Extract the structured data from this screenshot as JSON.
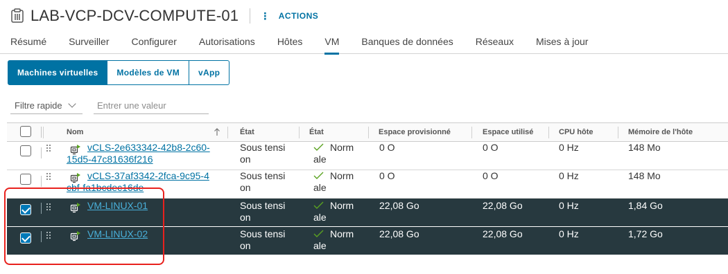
{
  "header": {
    "title": "LAB-VCP-DCV-COMPUTE-01",
    "actions_label": "ACTIONS"
  },
  "tabs": [
    {
      "label": "Résumé"
    },
    {
      "label": "Surveiller"
    },
    {
      "label": "Configurer"
    },
    {
      "label": "Autorisations"
    },
    {
      "label": "Hôtes"
    },
    {
      "label": "VM",
      "active": true
    },
    {
      "label": "Banques de données"
    },
    {
      "label": "Réseaux"
    },
    {
      "label": "Mises à jour"
    }
  ],
  "segments": [
    {
      "label": "Machines virtuelles",
      "active": true
    },
    {
      "label": "Modèles de VM"
    },
    {
      "label": "vApp"
    }
  ],
  "filter": {
    "select_value": "Filtre rapide",
    "input_placeholder": "Entrer une valeur"
  },
  "table": {
    "columns": {
      "name": "Nom",
      "state": "État",
      "status": "État",
      "provisioned": "Espace provisionné",
      "used": "Espace utilisé",
      "cpu": "CPU hôte",
      "memory": "Mémoire de l'hôte"
    },
    "rows": [
      {
        "name_line1": "vCLS-2e633342-42b8-2c60-",
        "name_line2": "15d5-47c81636f216",
        "state_line1": "Sous tensi",
        "state_line2": "on",
        "status_line1": "Norm",
        "status_line2": "ale",
        "provisioned": "0 O",
        "used": "0 O",
        "cpu": "0 Hz",
        "memory": "148 Mo",
        "selected": false
      },
      {
        "name_line1": "vCLS-37af3342-2fca-9c95-4",
        "name_line2": "cbf-fa1bcdec16de",
        "state_line1": "Sous tensi",
        "state_line2": "on",
        "status_line1": "Norm",
        "status_line2": "ale",
        "provisioned": "0 O",
        "used": "0 O",
        "cpu": "0 Hz",
        "memory": "148 Mo",
        "selected": false
      },
      {
        "name_line1": "VM-LINUX-01",
        "name_line2": "",
        "state_line1": "Sous tensi",
        "state_line2": "on",
        "status_line1": "Norm",
        "status_line2": "ale",
        "provisioned": "22,08 Go",
        "used": "22,08 Go",
        "cpu": "0 Hz",
        "memory": "1,84 Go",
        "selected": true
      },
      {
        "name_line1": "VM-LINUX-02",
        "name_line2": "",
        "state_line1": "Sous tensi",
        "state_line2": "on",
        "status_line1": "Norm",
        "status_line2": "ale",
        "provisioned": "22,08 Go",
        "used": "22,08 Go",
        "cpu": "0 Hz",
        "memory": "1,72 Go",
        "selected": true
      }
    ]
  },
  "colors": {
    "accent": "#0072a3",
    "selected_row_bg": "#27393f",
    "status_ok": "#5aa220",
    "annotation_box": "#e8211d"
  },
  "icons": {
    "title": "cluster-icon",
    "actions": "more-vertical-icon",
    "sort": "arrow-up-icon",
    "vm": "vm-powered-on-icon",
    "status": "check-icon"
  }
}
